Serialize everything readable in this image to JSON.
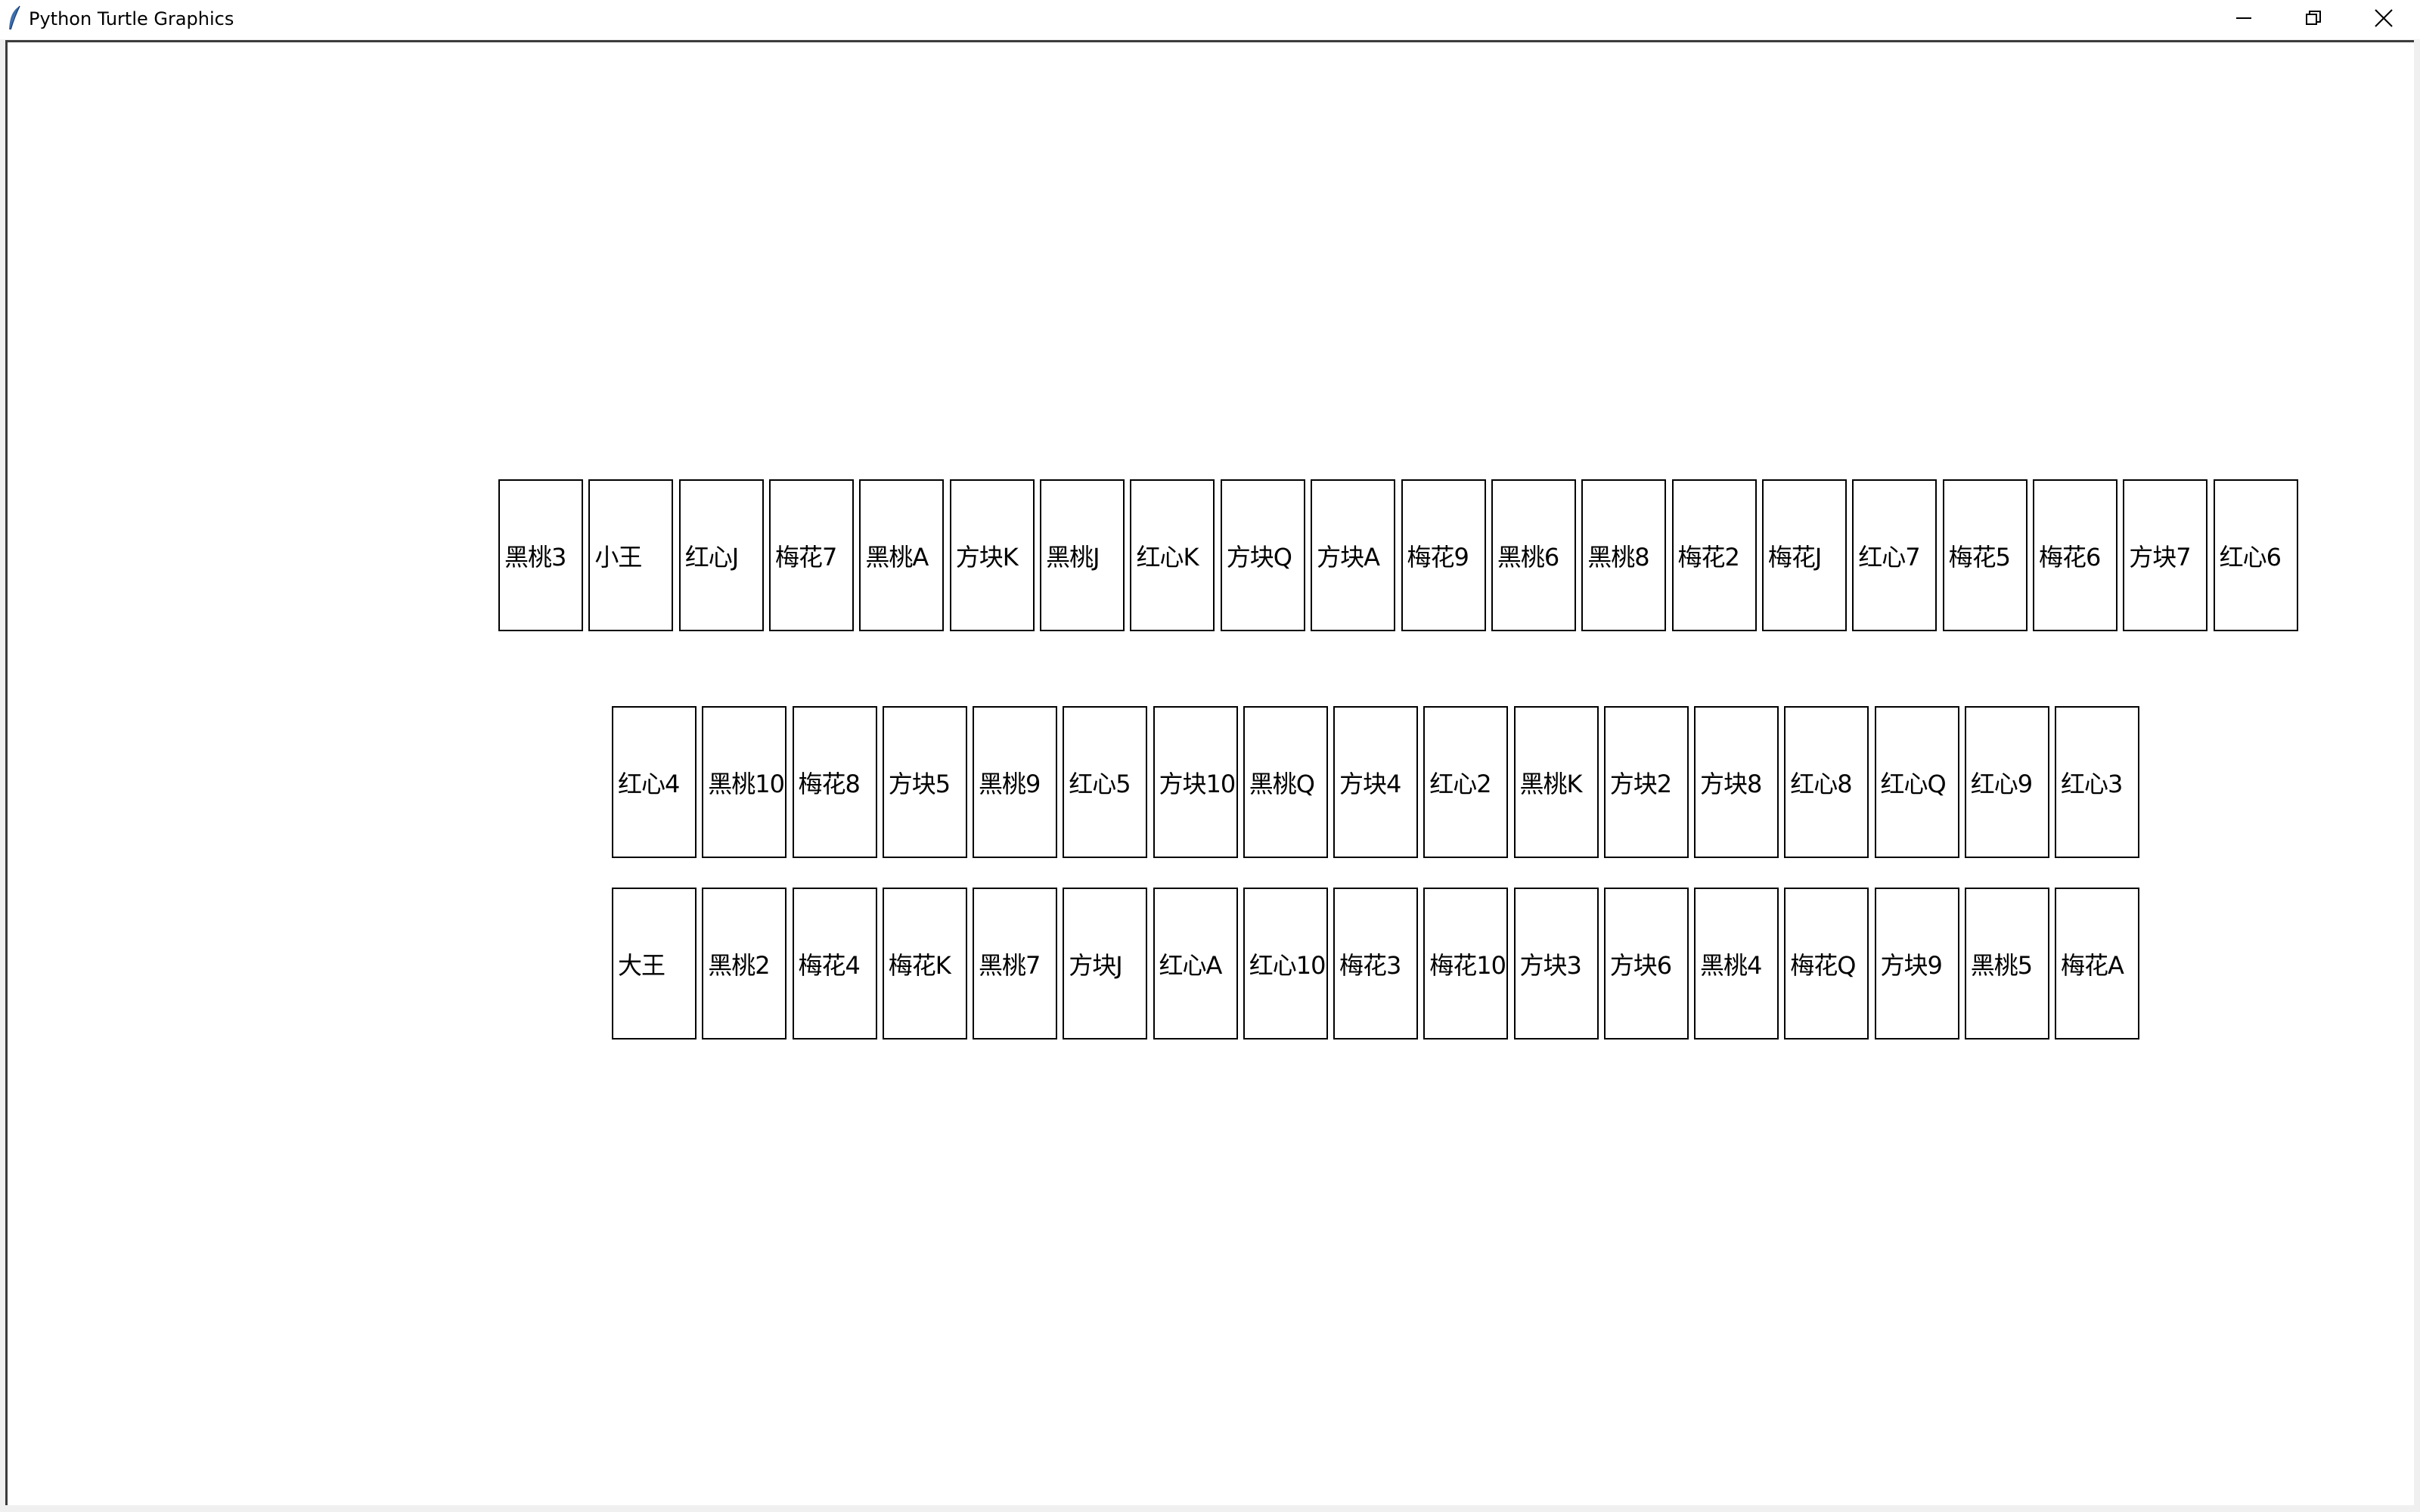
{
  "window": {
    "title": "Python Turtle Graphics",
    "icon": "feather-icon",
    "controls": {
      "minimize_icon": "minimize-icon",
      "maximize_icon": "restore-icon",
      "close_icon": "close-icon"
    }
  },
  "canvas": {
    "rows": [
      {
        "cards": [
          "黑桃3",
          "小王",
          "红心J",
          "梅花7",
          "黑桃A",
          "方块K",
          "黑桃J",
          "红心K",
          "方块Q",
          "方块A",
          "梅花9",
          "黑桃6",
          "黑桃8",
          "梅花2",
          "梅花J",
          "红心7",
          "梅花5",
          "梅花6",
          "方块7",
          "红心6"
        ]
      },
      {
        "cards": [
          "红心4",
          "黑桃10",
          "梅花8",
          "方块5",
          "黑桃9",
          "红心5",
          "方块10",
          "黑桃Q",
          "方块4",
          "红心2",
          "黑桃K",
          "方块2",
          "方块8",
          "红心8",
          "红心Q",
          "红心9",
          "红心3"
        ]
      },
      {
        "cards": [
          "大王",
          "黑桃2",
          "梅花4",
          "梅花K",
          "黑桃7",
          "方块J",
          "红心A",
          "红心10",
          "梅花3",
          "梅花10",
          "方块3",
          "方块6",
          "黑桃4",
          "梅花Q",
          "方块9",
          "黑桃5",
          "梅花A"
        ]
      }
    ]
  }
}
